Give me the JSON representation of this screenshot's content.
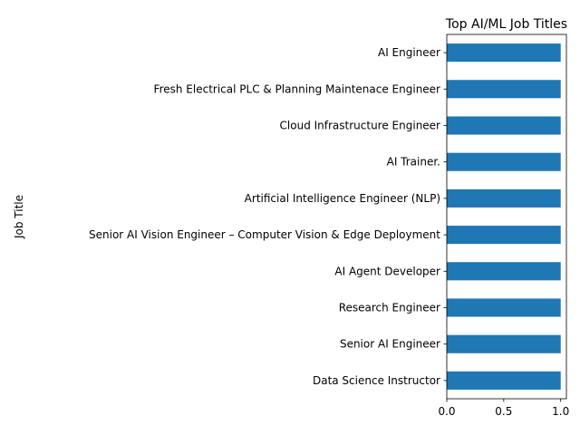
{
  "chart_data": {
    "type": "bar",
    "orientation": "horizontal",
    "title": "Top AI/ML Job Titles",
    "xlabel": "",
    "ylabel": "Job Title",
    "xlim": [
      0,
      1.05
    ],
    "xticks": [
      0.0,
      0.5,
      1.0
    ],
    "xtick_labels": [
      "0.0",
      "0.5",
      "1.0"
    ],
    "grid": false,
    "bar_color": "#1f77b4",
    "categories": [
      "AI Engineer",
      "Fresh Electrical PLC & Planning Maintenace Engineer",
      "Cloud Infrastructure Engineer",
      "AI Trainer.",
      "Artificial Intelligence Engineer (NLP)",
      "Senior AI Vision Engineer – Computer Vision & Edge Deployment",
      "AI Agent Developer",
      "Research Engineer",
      "Senior AI Engineer",
      "Data Science Instructor"
    ],
    "values": [
      1,
      1,
      1,
      1,
      1,
      1,
      1,
      1,
      1,
      1
    ]
  }
}
